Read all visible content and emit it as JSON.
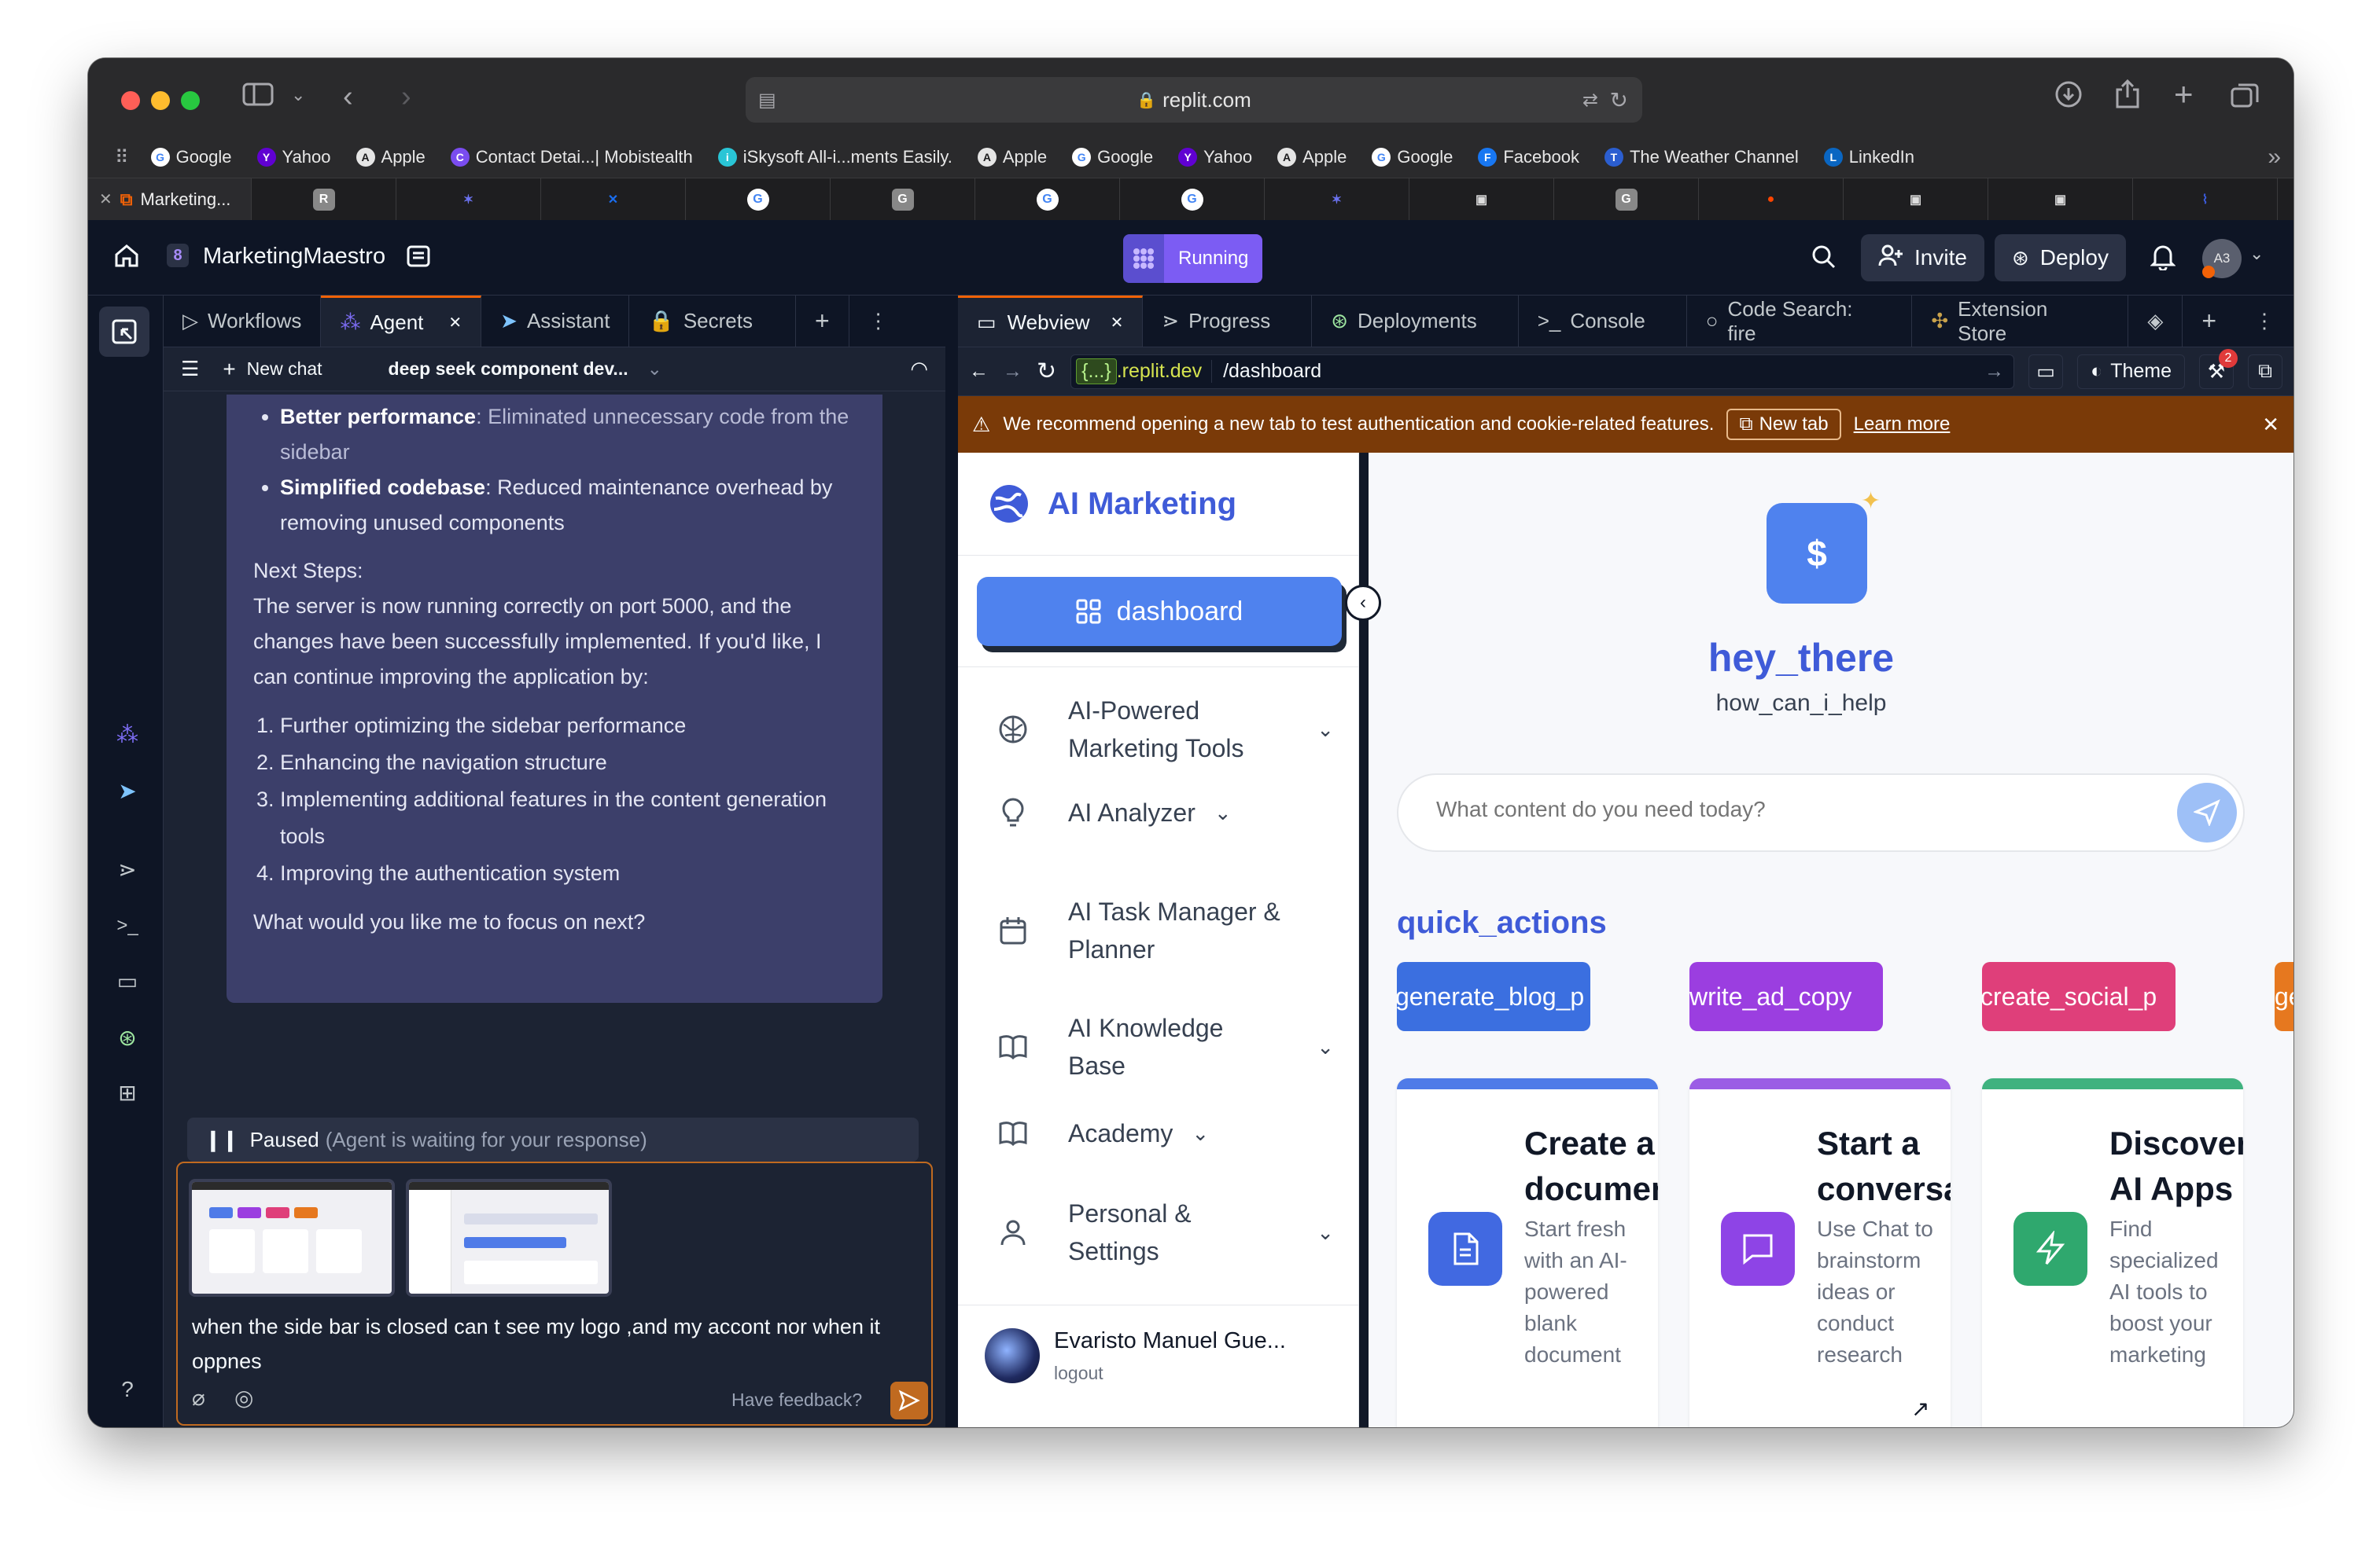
{
  "browser": {
    "url": "replit.com",
    "favorites": [
      {
        "label": "Google",
        "icon": "google-icon",
        "color": "#4285f4"
      },
      {
        "label": "Yahoo",
        "icon": "yahoo-icon",
        "color": "#6001d2"
      },
      {
        "label": "Apple",
        "icon": "apple-icon",
        "color": "#e5e5e5"
      },
      {
        "label": "Contact Detai...| Mobistealth",
        "icon": "mobistealth-icon",
        "color": "#7a4cf0"
      },
      {
        "label": "iSkysoft All-i...ments Easily.",
        "icon": "iskysoft-icon",
        "color": "#29c5d6"
      },
      {
        "label": "Apple",
        "icon": "apple-icon",
        "color": "#e5e5e5"
      },
      {
        "label": "Google",
        "icon": "google-icon",
        "color": "#4285f4"
      },
      {
        "label": "Yahoo",
        "icon": "yahoo-icon",
        "color": "#6001d2"
      },
      {
        "label": "Apple",
        "icon": "apple-icon",
        "color": "#e5e5e5"
      },
      {
        "label": "Google",
        "icon": "google-icon",
        "color": "#4285f4"
      },
      {
        "label": "Facebook",
        "icon": "facebook-icon",
        "color": "#1877f2"
      },
      {
        "label": "The Weather Channel",
        "icon": "weather-channel-icon",
        "color": "#2b5ed0"
      },
      {
        "label": "LinkedIn",
        "icon": "linkedin-icon",
        "color": "#0a66c2"
      }
    ],
    "first_tab": "Marketing...",
    "tabs": [
      {
        "icon": "r-icon",
        "glyph": "R",
        "color": "#888"
      },
      {
        "icon": "network-icon",
        "glyph": "✶",
        "color": "#6b72f0"
      },
      {
        "icon": "bluesky-icon",
        "glyph": "✕",
        "color": "#1a6ef0"
      },
      {
        "icon": "google-icon",
        "glyph": "G",
        "color": "#fff"
      },
      {
        "icon": "g-icon",
        "glyph": "G",
        "color": "#888"
      },
      {
        "icon": "google-icon",
        "glyph": "G",
        "color": "#fff"
      },
      {
        "icon": "google-icon",
        "glyph": "G",
        "color": "#fff"
      },
      {
        "icon": "network-icon",
        "glyph": "✶",
        "color": "#6b72f0"
      },
      {
        "icon": "bot-icon",
        "glyph": "▣",
        "color": "#ddd"
      },
      {
        "icon": "g-icon",
        "glyph": "G",
        "color": "#888"
      },
      {
        "icon": "reddit-icon",
        "glyph": "●",
        "color": "#ff4500"
      },
      {
        "icon": "bot-icon",
        "glyph": "▣",
        "color": "#ddd"
      },
      {
        "icon": "bot-icon",
        "glyph": "▣",
        "color": "#ddd"
      },
      {
        "icon": "feather-icon",
        "glyph": "⌇",
        "color": "#3b5bdb"
      }
    ]
  },
  "replit": {
    "project": "MarketingMaestro",
    "run_label": "Running",
    "invite": "Invite",
    "deploy": "Deploy",
    "avatar": "A3"
  },
  "left_panel": {
    "tabs": [
      "Workflows",
      "Agent",
      "Assistant",
      "Secrets"
    ],
    "new_chat": "New chat",
    "chat_title": "deep seek component dev...",
    "message": {
      "bullet1_bold": "Better performance",
      "bullet1_text": ": Eliminated unnecessary code from the sidebar",
      "bullet2_bold": "Simplified codebase",
      "bullet2_text": ": Reduced maintenance overhead by removing unused components",
      "next_steps": "Next Steps:",
      "paragraph": "The server is now running correctly on port 5000, and the changes have been successfully implemented. If you'd like, I can continue improving the application by:",
      "steps": [
        "Further optimizing the sidebar performance",
        "Enhancing the navigation structure",
        "Implementing additional features in the content generation tools",
        "Improving the authentication system"
      ],
      "question": "What would you like me to focus on next?"
    },
    "paused_label": "Paused",
    "paused_detail": "(Agent is waiting for your response)",
    "input_text": "when the side bar is closed can t see my logo ,and my accont nor when it oppnes",
    "feedback": "Have feedback?"
  },
  "right_panel": {
    "tabs": [
      "Webview",
      "Progress",
      "Deployments",
      "Console",
      "Code Search: fire",
      "Extension Store"
    ],
    "domain_badge": "{...}",
    "domain": ".replit.dev",
    "path": "/dashboard",
    "theme": "Theme",
    "notif_count": "2",
    "banner_text": "We recommend opening a new tab to test authentication and cookie-related features.",
    "banner_button": "New tab",
    "banner_link": "Learn more"
  },
  "app": {
    "brand": "AI Marketing",
    "dashboard": "dashboard",
    "nav": [
      {
        "label": "AI-Powered Marketing Tools",
        "icon": "brain-icon",
        "chevron": true
      },
      {
        "label": "AI Analyzer",
        "icon": "lightbulb-icon",
        "chevron": true
      },
      {
        "label": "AI Task Manager & Planner",
        "icon": "calendar-icon",
        "chevron": false
      },
      {
        "label": "AI Knowledge Base",
        "icon": "book-icon",
        "chevron": true
      },
      {
        "label": "Academy",
        "icon": "book-open-icon",
        "chevron": true
      },
      {
        "label": "Personal & Settings",
        "icon": "user-icon",
        "chevron": true
      }
    ],
    "user_name": "Evaristo Manuel Gue...",
    "logout": "logout",
    "greeting": "hey_there",
    "sub_greeting": "how_can_i_help",
    "search_placeholder": "What content do you need today?",
    "quick_actions_title": "quick_actions",
    "quick_actions": [
      {
        "label": "generate_blog_p",
        "color": "#3b6fe0"
      },
      {
        "label": "write_ad_copy",
        "color": "#9b3ee0"
      },
      {
        "label": "create_social_p",
        "color": "#df3f7a"
      },
      {
        "label": "generate_imag",
        "color": "#e6781f"
      }
    ],
    "cards": [
      {
        "title": "Create a document",
        "desc": "Start fresh with an AI-powered blank document",
        "bar": "#4f7be8",
        "icon_bg": "#4169e1",
        "icon": "document-icon"
      },
      {
        "title": "Start a conversation",
        "desc": "Use Chat to brainstorm ideas or conduct research",
        "bar": "#9b5de5",
        "icon_bg": "#8e44e6",
        "icon": "chat-icon"
      },
      {
        "title": "Discover AI Apps",
        "desc": "Find specialized AI tools to boost your marketing",
        "bar": "#3fb27f",
        "icon_bg": "#2fa86e",
        "icon": "lightning-icon"
      }
    ]
  }
}
